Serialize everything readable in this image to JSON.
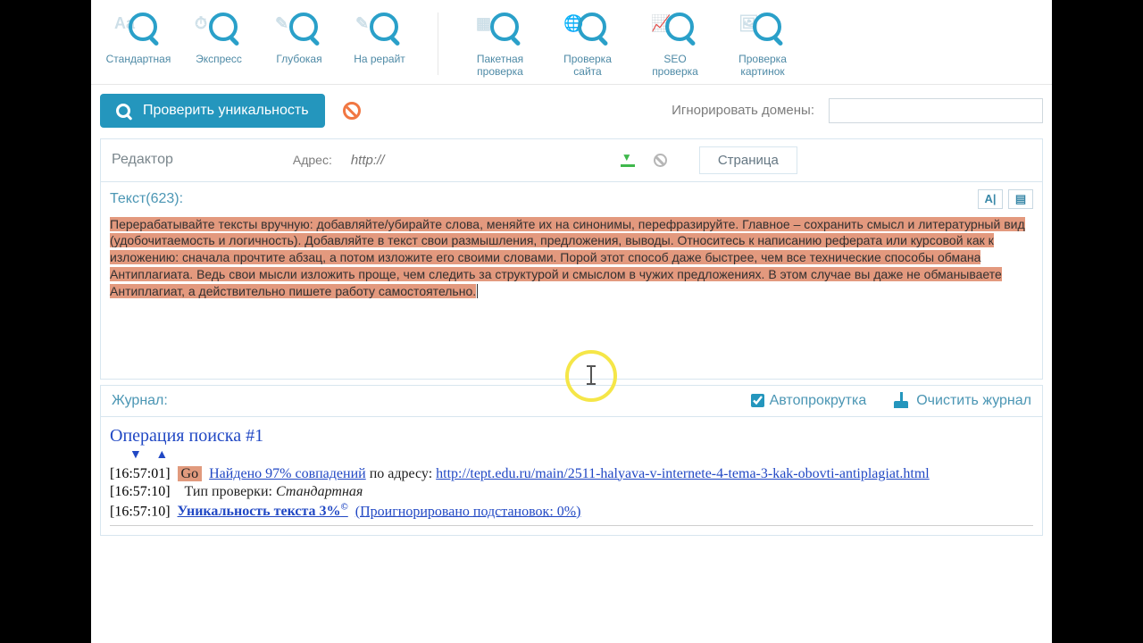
{
  "toolbar": {
    "left": [
      {
        "label": "Стандартная",
        "badge": "Aa"
      },
      {
        "label": "Экспресс",
        "badge": "⏱"
      },
      {
        "label": "Глубокая",
        "badge": "✎"
      },
      {
        "label": "На рерайт",
        "badge": "✎"
      }
    ],
    "right": [
      {
        "label": "Пакетная\nпроверка",
        "badge": "▦"
      },
      {
        "label": "Проверка\nсайта",
        "badge": "🌐"
      },
      {
        "label": "SEO\nпроверка",
        "badge": "📈"
      },
      {
        "label": "Проверка\nкартинок",
        "badge": "🖼"
      }
    ]
  },
  "actions": {
    "check_label": "Проверить уникальность",
    "ignore_label": "Игнорировать домены:",
    "ignore_value": ""
  },
  "editor": {
    "title": "Редактор",
    "addr_label": "Адрес:",
    "addr_placeholder": "http://",
    "tab_page": "Страница",
    "count_label": "Текст(623):",
    "content": "Перерабатывайте тексты вручную: добавляйте/убирайте слова, меняйте их на синонимы, перефразируйте. Главное – сохранить смысл и литературный вид (удобочитаемость и логичность).\nДобавляйте в текст свои размышления, предложения, выводы. Относитесь к написанию реферата или курсовой как к изложению: сначала прочтите абзац, а потом изложите его своими словами. Порой этот способ даже быстрее, чем все технические способы обмана Антиплагиата. Ведь свои мысли изложить проще, чем следить за структурой и смыслом в чужих предложениях. В этом случае вы даже не обманываете Антиплагиат, а действительно пишете работу самостоятельно."
  },
  "log": {
    "bar_title": "Журнал:",
    "autoscroll": "Автопрокрутка",
    "clear": "Очистить журнал",
    "op_title": "Операция поиска #1",
    "lines": {
      "l1_ts": "[16:57:01]",
      "l1_go": "Go",
      "l1_found": "Найдено 97% совпадений",
      "l1_by": " по адресу: ",
      "l1_url": "http://tept.edu.ru/main/2511-halyava-v-internete-4-tema-3-kak-obovti-antiplagiat.html",
      "l2_ts": "[16:57:10]",
      "l2_type_lbl": "Тип проверки: ",
      "l2_type_val": "Стандартная",
      "l3_ts": "[16:57:10]",
      "l3_uniq": "Уникальность текста 3%",
      "l3_sup": "©",
      "l3_ignored": "(Проигнорировано подстановок: 0%)"
    }
  }
}
